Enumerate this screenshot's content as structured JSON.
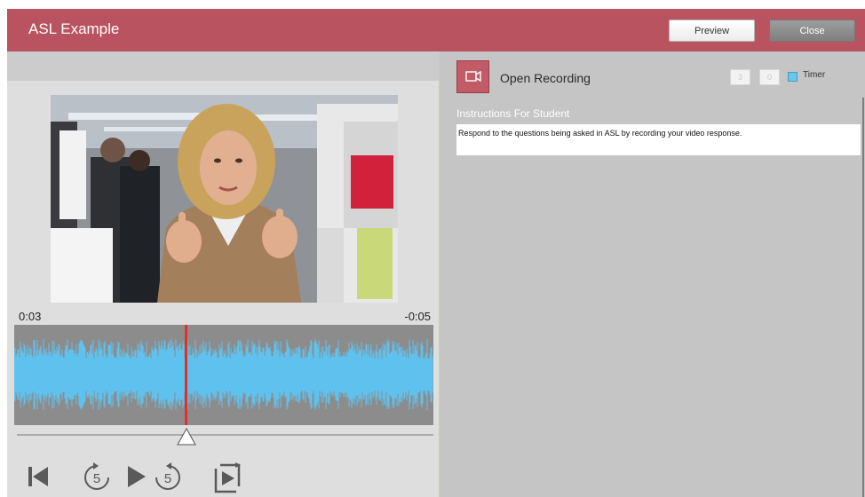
{
  "header": {
    "title": "ASL Example",
    "preview_label": "Preview",
    "close_label": "Close",
    "bar_color": "#b9535f"
  },
  "player": {
    "time_current": "0:03",
    "time_remaining": "-0:05",
    "playback_progress": 0.41,
    "waveform_color": "#5fc2ee",
    "playhead_color": "#e0302c",
    "controls": [
      {
        "name": "skip-to-start",
        "icon": "skip-back-icon"
      },
      {
        "name": "rewind-5",
        "icon": "rewind-5-icon",
        "label": "5"
      },
      {
        "name": "play",
        "icon": "play-icon"
      },
      {
        "name": "forward-5",
        "icon": "forward-5-icon",
        "label": "5"
      },
      {
        "name": "loop-play",
        "icon": "loop-play-icon"
      }
    ]
  },
  "recording": {
    "icon": "video-camera-icon",
    "label": "Open Recording",
    "timer_minutes": "3",
    "timer_seconds": "0",
    "timer_label": "Timer",
    "timer_checked": true
  },
  "instructions": {
    "title": "Instructions For Student",
    "text": "Respond to the questions being asked in ASL by recording your video response."
  }
}
